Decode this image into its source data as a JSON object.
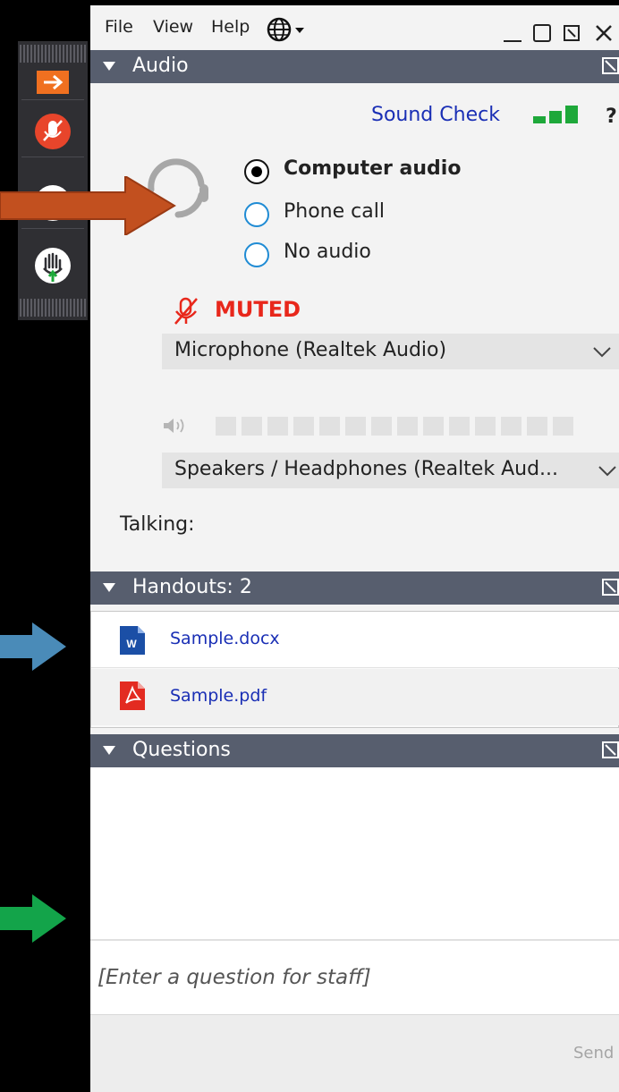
{
  "menu": {
    "file": "File",
    "view": "View",
    "help": "Help"
  },
  "audio": {
    "header": "Audio",
    "sound_check": "Sound Check",
    "help_mark": "?",
    "options": [
      {
        "label": "Computer audio",
        "selected": true
      },
      {
        "label": "Phone call",
        "selected": false
      },
      {
        "label": "No audio",
        "selected": false
      }
    ],
    "muted_label": "MUTED",
    "microphone": "Microphone (Realtek Audio)",
    "speakers": "Speakers / Headphones (Realtek Aud...",
    "talking_label": "Talking:"
  },
  "handouts": {
    "header": "Handouts: 2",
    "files": [
      {
        "name": "Sample.docx",
        "icon": "word-doc-icon",
        "icon_text": "W"
      },
      {
        "name": "Sample.pdf",
        "icon": "pdf-icon"
      }
    ]
  },
  "questions": {
    "header": "Questions",
    "placeholder": "[Enter a question for staff]",
    "send_label": "Send"
  },
  "colors": {
    "panel_header": "#575e6e",
    "muted_red": "#e8271b",
    "link_blue": "#1a2fb5",
    "arrow_orange": "#c2501f",
    "arrow_blue": "#4a8bb8",
    "arrow_green": "#13a44a",
    "sound_green": "#1ea83a"
  }
}
